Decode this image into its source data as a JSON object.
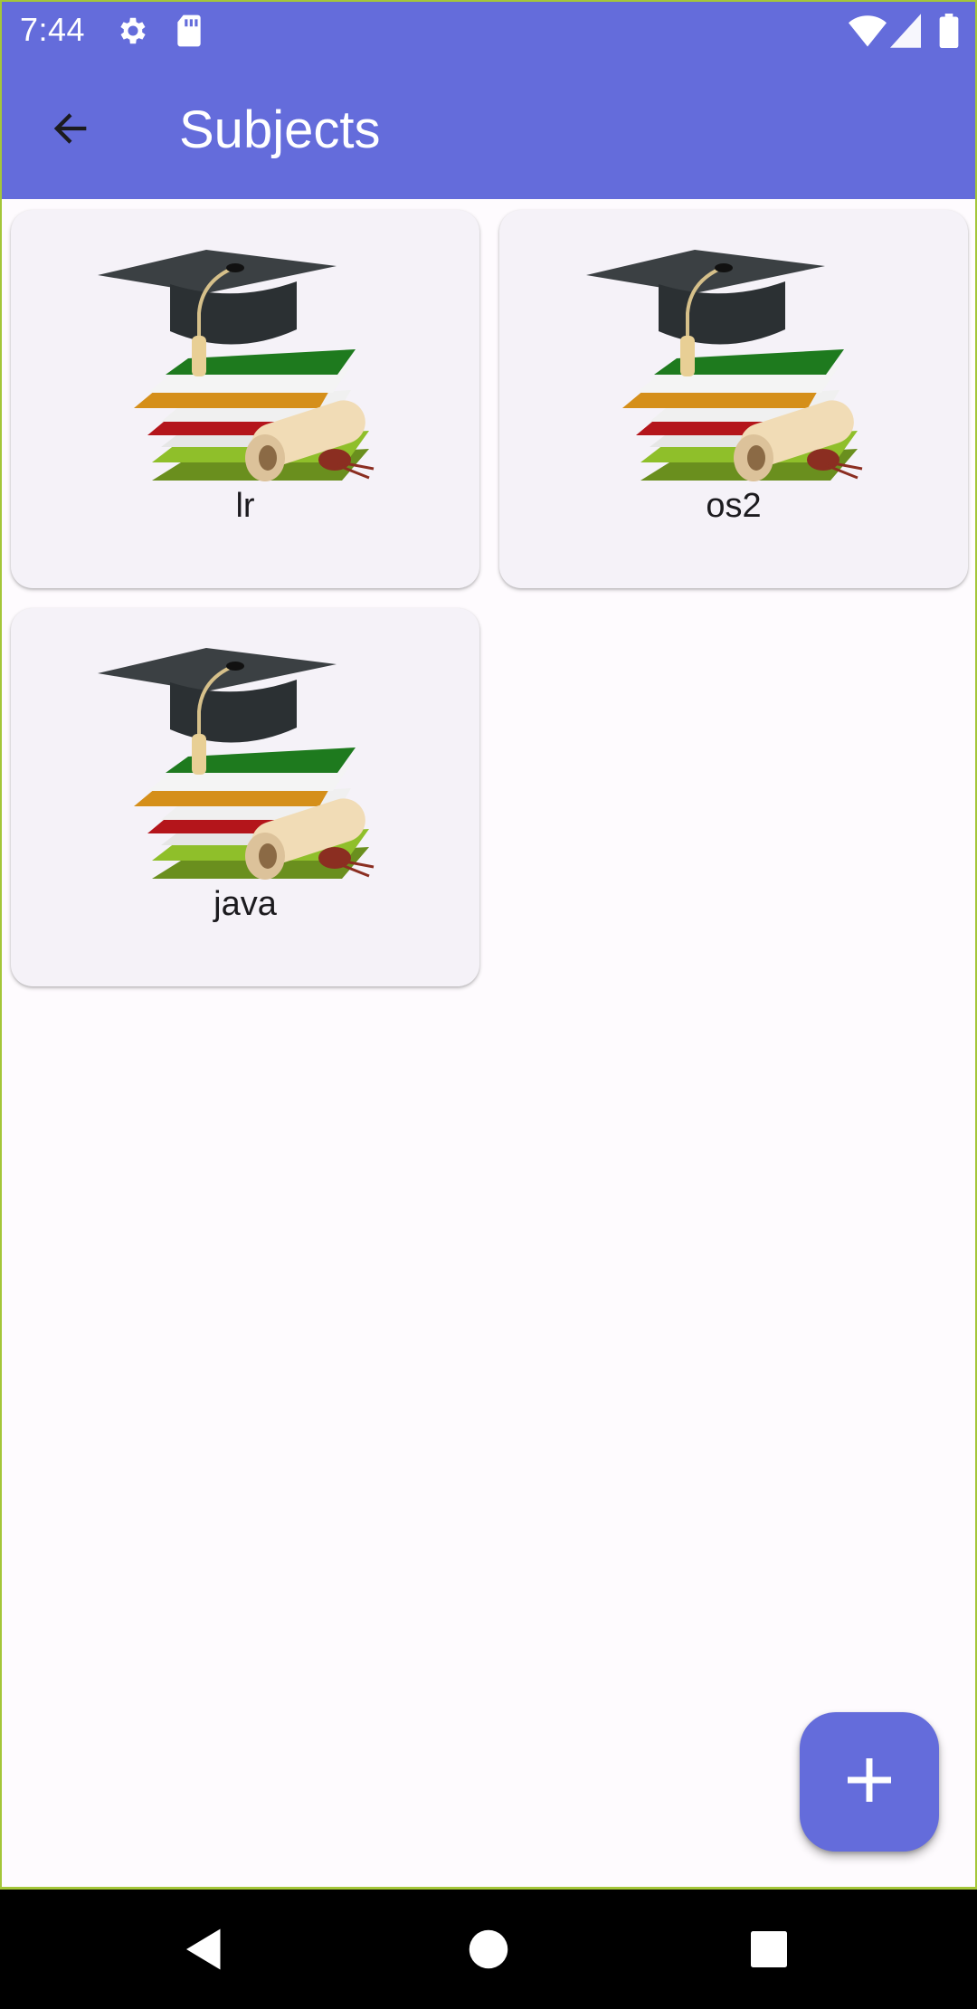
{
  "status_bar": {
    "time": "7:44",
    "icons": [
      "settings-icon",
      "sd-card-icon",
      "wifi-icon",
      "cell-signal-icon",
      "battery-icon"
    ]
  },
  "app_bar": {
    "title": "Subjects",
    "back_icon": "arrow-back-icon"
  },
  "subjects": [
    {
      "label": "lr",
      "image": "graduation-books-image"
    },
    {
      "label": "os2",
      "image": "graduation-books-image"
    },
    {
      "label": "java",
      "image": "graduation-books-image"
    }
  ],
  "fab": {
    "icon": "plus-icon"
  },
  "nav_bar": {
    "icons": [
      "back-triangle-icon",
      "home-circle-icon",
      "recents-square-icon"
    ]
  },
  "colors": {
    "primary": "#646cdb",
    "background": "#fefbfe",
    "card": "#f5f2f8",
    "text": "#1c1b1f"
  }
}
